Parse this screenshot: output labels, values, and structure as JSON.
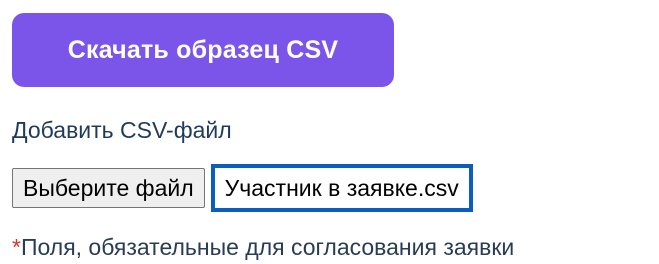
{
  "download": {
    "label": "Скачать образец CSV"
  },
  "upload": {
    "label": "Добавить CSV-файл",
    "choose_button": "Выберите файл",
    "selected_file": "Участник в заявке.csv"
  },
  "required_note": {
    "asterisk": "*",
    "text": "Поля, обязательные для согласования заявки"
  },
  "colors": {
    "primary_button": "#7b55ea",
    "focus_border": "#0a5fbe",
    "asterisk": "#e0342a"
  }
}
